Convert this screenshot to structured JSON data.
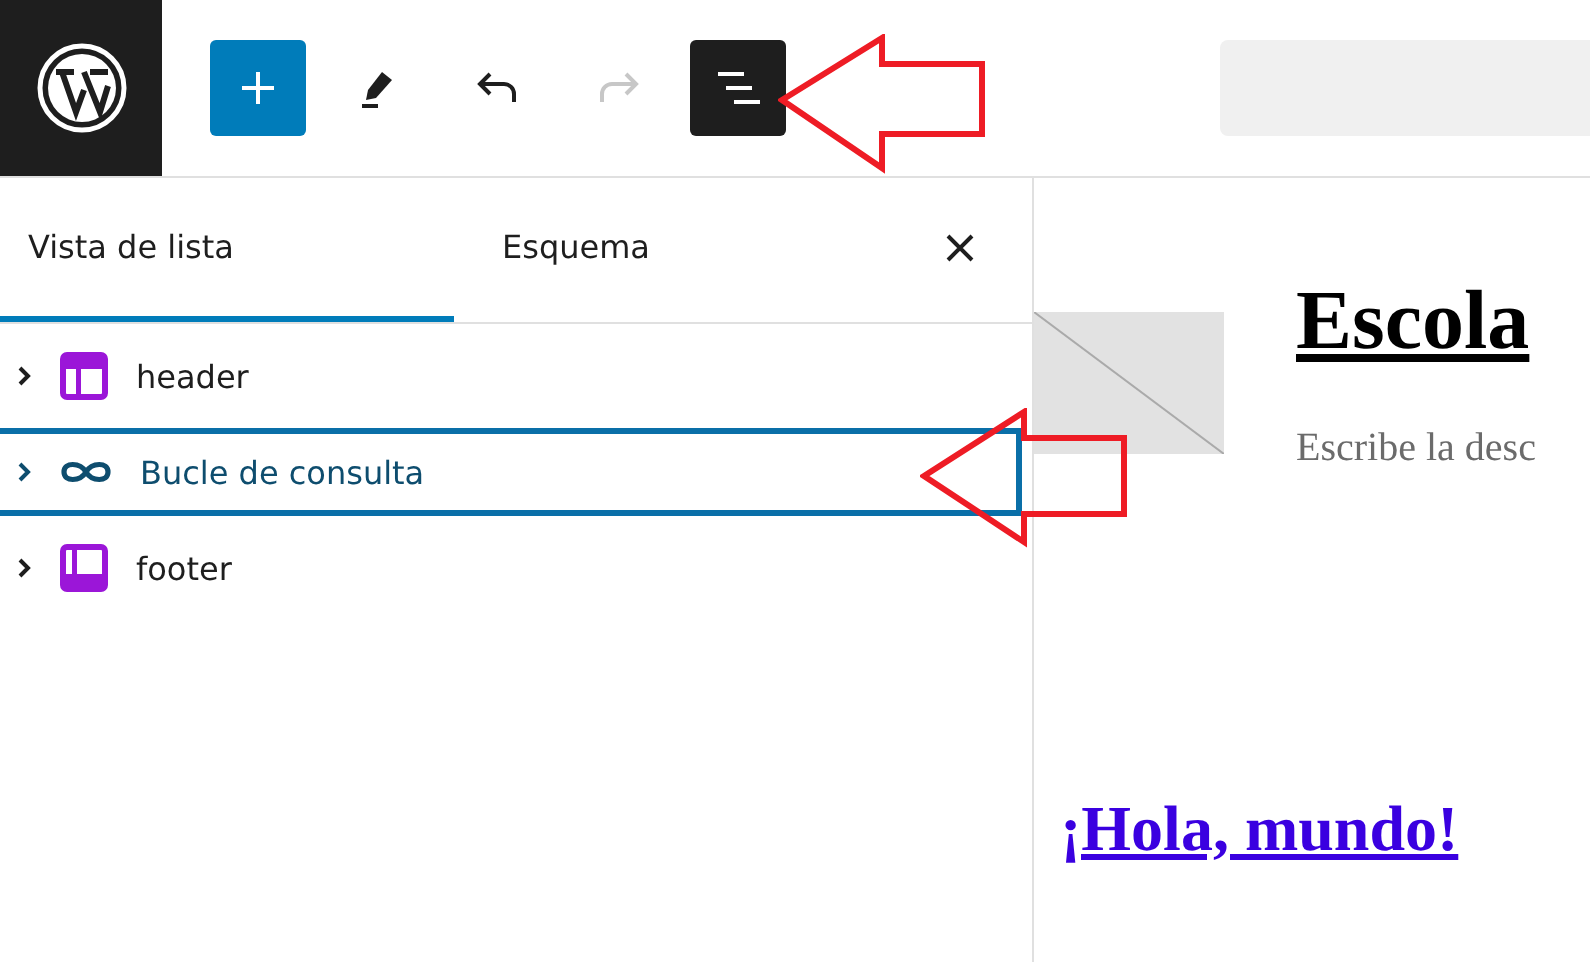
{
  "toolbar": {
    "tools": [
      {
        "kind": "add",
        "selected": false,
        "disabled": false
      },
      {
        "kind": "edit",
        "selected": false,
        "disabled": false
      },
      {
        "kind": "undo",
        "selected": false,
        "disabled": false
      },
      {
        "kind": "redo",
        "selected": false,
        "disabled": true
      },
      {
        "kind": "list",
        "selected": true,
        "disabled": false
      }
    ]
  },
  "panel": {
    "tabs": [
      {
        "label": "Vista de lista",
        "selected": true
      },
      {
        "label": "Esquema",
        "selected": false
      }
    ],
    "rows": [
      {
        "label": "header",
        "kind": "header",
        "selected": false
      },
      {
        "label": "Bucle de consulta",
        "kind": "loop",
        "selected": true
      },
      {
        "label": "footer",
        "kind": "footer",
        "selected": false
      }
    ]
  },
  "canvas": {
    "site_title": "Escola",
    "tagline": "Escribe la desc",
    "post_link": "¡Hola, mundo!"
  }
}
